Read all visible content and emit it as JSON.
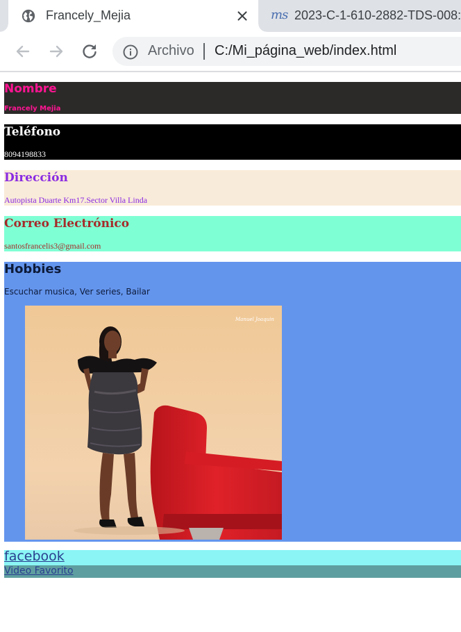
{
  "browser": {
    "tabs": [
      {
        "title": "Francely_Mejia",
        "active": true,
        "icon": "globe-icon"
      },
      {
        "title": "2023-C-1-610-2882-TDS-008:",
        "active": false,
        "icon": "site-favicon",
        "favicon_text": "ms"
      }
    ],
    "omnibox": {
      "scheme_label": "Archivo",
      "url": "C:/Mi_página_web/index.html"
    }
  },
  "profile": {
    "nombre": {
      "heading": "Nombre",
      "value": "Francely Mejia"
    },
    "telefono": {
      "heading": "Teléfono",
      "value": "8094198833"
    },
    "direccion": {
      "heading": "Dirección",
      "value": "Autopista Duarte Km17.Sector Villa Linda"
    },
    "correo": {
      "heading": "Correo Electrónico",
      "value": "santosfrancelis3@gmail.com"
    },
    "hobbies": {
      "heading": "Hobbies",
      "value": "Escuchar musica, Ver series, Bailar"
    }
  },
  "photo": {
    "signature_text": "Manuel Joaquin"
  },
  "links": {
    "facebook": "facebook",
    "video": "Video Favorito"
  },
  "colors": {
    "nombre_bg": "#2c2a28",
    "nombre_text": "#ff1493",
    "telefono_bg": "#000000",
    "direccion_bg": "#f9ebd9",
    "direccion_text": "#8a2be2",
    "correo_bg": "#7fffd4",
    "correo_text": "#a52a2a",
    "hobbies_bg": "#6495ed",
    "facebook_bg": "#8bf5f5",
    "video_bg": "#5f9ea0"
  }
}
